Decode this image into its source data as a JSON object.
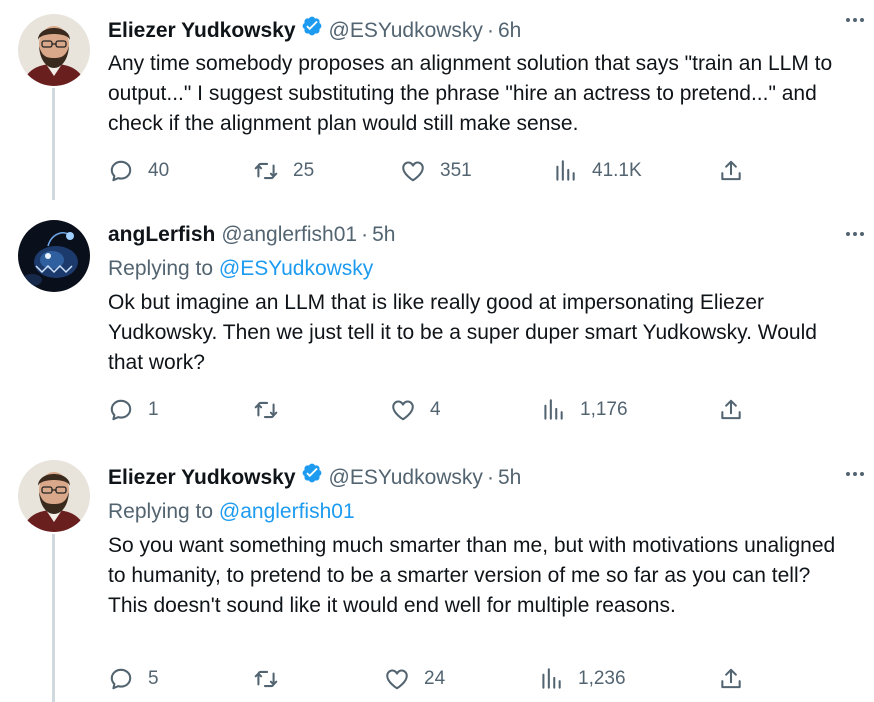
{
  "colors": {
    "accent": "#1d9bf0",
    "muted": "#536471",
    "text": "#0f1419",
    "verified": "#1d9bf0"
  },
  "tweets": [
    {
      "name": "Eliezer Yudkowsky",
      "verified": true,
      "handle": "@ESYudkowsky",
      "dot": "·",
      "time": "6h",
      "replying_label": "",
      "replying_to": "",
      "text": "Any time somebody proposes an alignment solution that says \"train an LLM to output...\" I suggest substituting the phrase \"hire an actress to pretend...\" and check if the alignment plan would still make sense.",
      "replies": "40",
      "retweets": "25",
      "likes": "351",
      "views": "41.1K",
      "avatar_icon": "bearded-man-avatar"
    },
    {
      "name": "angLerfish",
      "verified": false,
      "handle": "@anglerfish01",
      "dot": "·",
      "time": "5h",
      "replying_label": "Replying to",
      "replying_to": "@ESYudkowsky",
      "text": "Ok but imagine an LLM that is like really good at impersonating Eliezer Yudkowsky. Then we just tell it to be a super duper smart Yudkowsky. Would that work?",
      "replies": "1",
      "retweets": "",
      "likes": "4",
      "views": "1,176",
      "avatar_icon": "anglerfish-avatar"
    },
    {
      "name": "Eliezer Yudkowsky",
      "verified": true,
      "handle": "@ESYudkowsky",
      "dot": "·",
      "time": "5h",
      "replying_label": "Replying to",
      "replying_to": "@anglerfish01",
      "text": "So you want something much smarter than me, but with motivations unaligned to humanity, to pretend to be a smarter version of me so far as you can tell?  This doesn't sound like it would end well for multiple reasons.",
      "replies": "5",
      "retweets": "",
      "likes": "24",
      "views": "1,236",
      "avatar_icon": "bearded-man-avatar"
    }
  ]
}
